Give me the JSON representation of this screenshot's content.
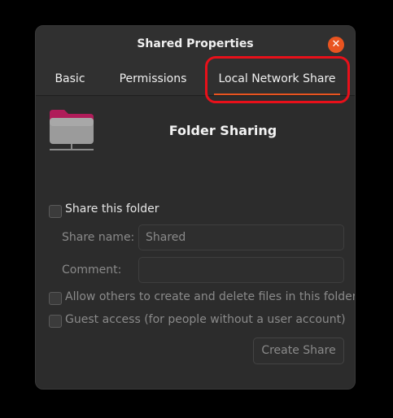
{
  "window": {
    "title": "Shared Properties"
  },
  "tabs": [
    {
      "label": "Basic",
      "active": false
    },
    {
      "label": "Permissions",
      "active": false
    },
    {
      "label": "Local Network Share",
      "active": true
    }
  ],
  "heading": "Folder Sharing",
  "share_this_folder": {
    "label": "Share this folder",
    "checked": false
  },
  "share_name": {
    "label": "Share name:",
    "value": "Shared"
  },
  "comment": {
    "label": "Comment:",
    "value": ""
  },
  "allow_others": {
    "label": "Allow others to create and delete files in this folder",
    "checked": false
  },
  "guest_access": {
    "label": "Guest access (for people without a user account)",
    "checked": false
  },
  "create_button_label": "Create Share",
  "colors": {
    "accent": "#e95420",
    "highlight": "#e8101a",
    "background": "#2c2c2c"
  },
  "icons": {
    "close": "close-icon",
    "folder": "shared-folder-icon"
  }
}
